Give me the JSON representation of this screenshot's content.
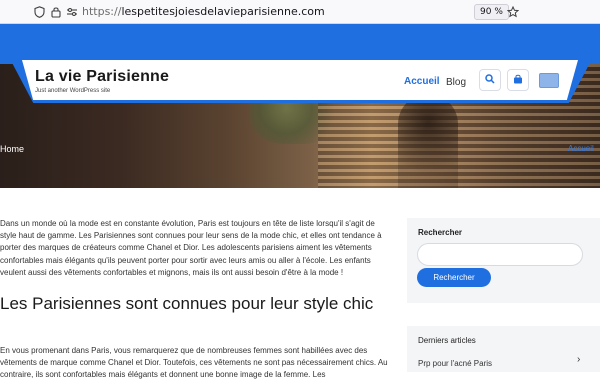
{
  "browser": {
    "url_protocol": "https://",
    "url_domain": "lespetitesjoiesdelavieparisienne.com",
    "zoom": "90 %"
  },
  "site": {
    "title": "La vie Parisienne",
    "tagline": "Just another WordPress site",
    "nav": [
      "Accueil",
      "Blog"
    ],
    "accent": "#1f6fe0"
  },
  "hero": {
    "left_label": "Home",
    "right_label": "Accueil"
  },
  "article": {
    "intro": "Dans un monde où la mode est en constante évolution, Paris est toujours en tête de liste lorsqu'il s'agit de style haut de gamme. Les Parisiennes sont connues pour leur sens de la mode chic, et elles ont tendance à porter des marques de créateurs comme Chanel et Dior. Les adolescents parisiens aiment les vêtements confortables mais élégants qu'ils peuvent porter pour sortir avec leurs amis ou aller à l'école. Les enfants veulent aussi des vêtements confortables et mignons, mais ils ont aussi besoin d'être à la mode !",
    "heading": "Les Parisiennes sont connues pour leur style chic",
    "body": "En vous promenant dans Paris, vous remarquerez que de nombreuses femmes sont habillées avec des vêtements de marque comme Chanel et Dior. Toutefois, ces vêtements ne sont pas nécessairement chics. Au contraire, ils sont confortables mais élégants et donnent une bonne image de la femme. Les"
  },
  "sidebar": {
    "search_title": "Rechercher",
    "search_placeholder": "",
    "search_button": "Rechercher",
    "recent_title": "Derniers articles",
    "recent_items": [
      "Prp pour l'acné Paris"
    ]
  }
}
